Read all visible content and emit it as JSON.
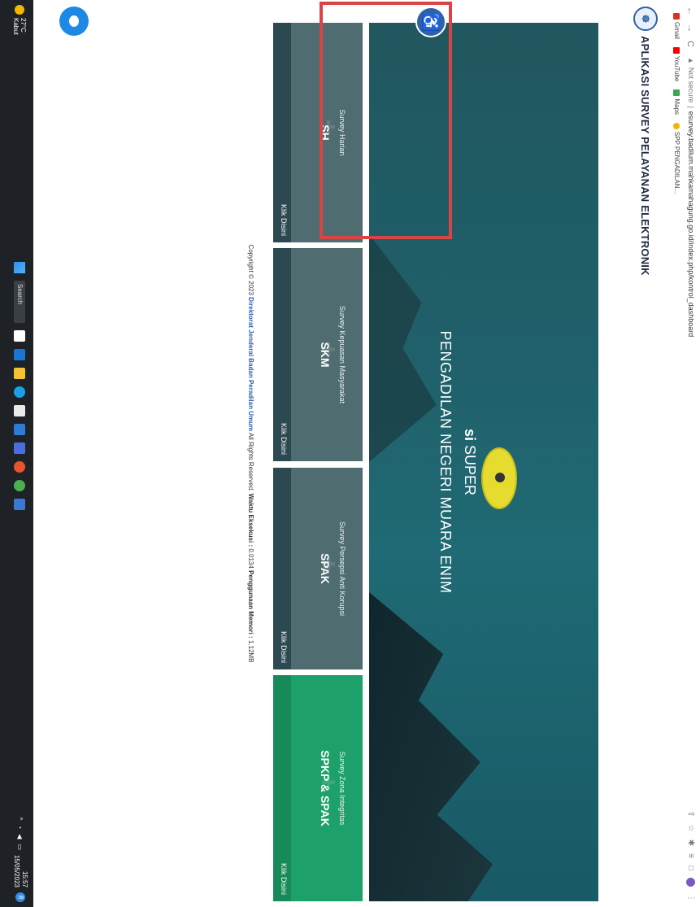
{
  "browser": {
    "security": "Not secure",
    "url": "esurvey.badilum.mahkamahagung.go.id/index.php/kontrol_dashboard",
    "bookmarks": [
      "Gmail",
      "YouTube",
      "Maps",
      "SPP PENGADILAN..."
    ]
  },
  "app": {
    "title": "APLIKASI SURVEY PELAYANAN ELEKTRONIK"
  },
  "hero": {
    "title_bold": "si",
    "title_rest": "SUPER",
    "subtitle": "PENGADILAN NEGERI MUARA ENIM"
  },
  "cards": [
    {
      "subtitle": "Survey Harian",
      "code": "SH",
      "action": "Klik Disini"
    },
    {
      "subtitle": "Survey Kepuasan Masyarakat",
      "code": "SKM",
      "action": "Klik Disini"
    },
    {
      "subtitle": "Survey Persepsi Anti Korupsi",
      "code": "SPAK",
      "action": "Klik Disini"
    },
    {
      "subtitle": "Survey Zona Integritas",
      "code": "SPKP & SPAK",
      "action": "Klik Disini"
    }
  ],
  "footer": {
    "copyright": "Copyright © 2023",
    "org": "Direktorat Jenderal Badan Peradilan Umum",
    "rights": "All Rights Reserved.",
    "exec_label": "Waktu Eksekusi :",
    "exec_value": "0.0134",
    "mem_label": "Penggunaan Memori :",
    "mem_value": "1.12MB"
  },
  "taskbar": {
    "weather_temp": "27°C",
    "weather_desc": "Kabut",
    "search": "Search",
    "time": "15:57",
    "date": "15/05/2023",
    "notifications": "8"
  },
  "colors": {
    "hero": "#1f6a74",
    "card": "#4f6c70",
    "card_green": "#1ea06a",
    "highlight": "#d94545",
    "brand": "#2f62a8"
  }
}
